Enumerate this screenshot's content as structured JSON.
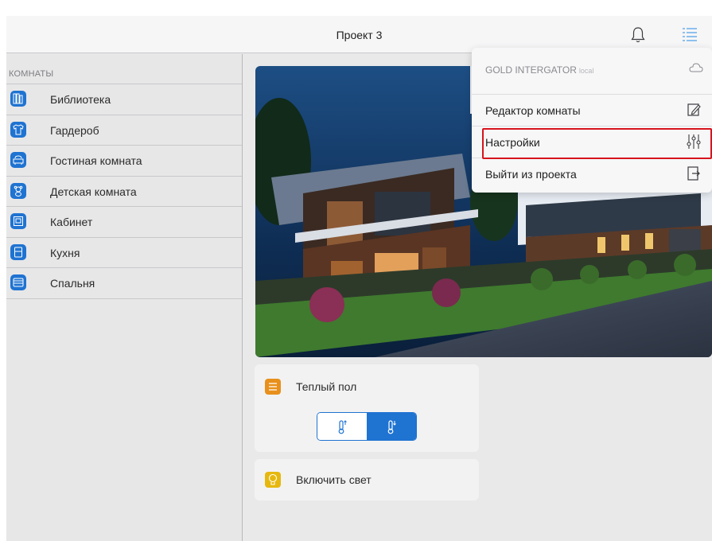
{
  "header": {
    "title": "Проект 3"
  },
  "sidebar": {
    "section_title": "КОМНАТЫ",
    "rooms": [
      {
        "label": "Библиотека"
      },
      {
        "label": "Гардероб"
      },
      {
        "label": "Гостиная комната"
      },
      {
        "label": "Детская комната"
      },
      {
        "label": "Кабинет"
      },
      {
        "label": "Кухня"
      },
      {
        "label": "Спальня"
      }
    ]
  },
  "devices": {
    "floor_heating": {
      "label": "Теплый пол",
      "icon_color": "#e8901c"
    },
    "light": {
      "label": "Включить свет",
      "icon_color": "#e6b80f"
    }
  },
  "menu": {
    "integrator": "GOLD INTERGATOR",
    "integrator_mode": "local",
    "items": [
      {
        "label": "Редактор комнаты",
        "icon": "edit-icon"
      },
      {
        "label": "Настройки",
        "icon": "sliders-icon"
      },
      {
        "label": "Выйти из проекта",
        "icon": "exit-icon"
      }
    ]
  },
  "colors": {
    "accent": "#1f73d1",
    "highlight": "#d6141c"
  }
}
